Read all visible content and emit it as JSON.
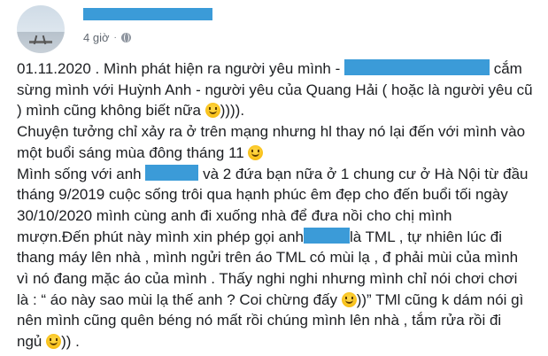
{
  "post": {
    "timestamp": "4 giờ",
    "separator": "·",
    "lines": [
      [
        "01.11.2020 . Mình phát hiện ra người yêu mình - ",
        " cắm"
      ],
      [
        "sừng mình với Huỳnh Anh - người yêu của Quang Hải ( hoặc là người yêu cũ"
      ],
      [
        ") mình cũng không biết nữa ",
        "))))."
      ],
      [
        "Chuyện tưởng chỉ xảy ra ở trên mạng nhưng hl thay nó lại đến với mình vào"
      ],
      [
        "một buổi sáng mùa đông tháng 11 ",
        ""
      ],
      [
        "Mình sống với anh ",
        " và 2 đứa bạn nữa ở 1 chung cư ở Hà Nội từ đầu"
      ],
      [
        "tháng 9/2019 cuộc sống trôi qua hạnh phúc êm đẹp cho đến buổi tối ngày"
      ],
      [
        "30/10/2020 mình cùng anh đi xuống nhà để đưa nồi cho chị mình"
      ],
      [
        "mượn.Đến phút này mình xin phép gọi anh",
        "là TML , tự nhiên lúc đi"
      ],
      [
        "thang máy lên nhà , mình ngửi trên áo TML có mùi lạ , đ phải mùi của mình"
      ],
      [
        "vì nó đang mặc áo của mình . Thấy nghi nghi nhưng mình chỉ nói chơi chơi"
      ],
      [
        "là : “ áo này sao mùi lạ thế anh ? Coi chừng đấy ",
        "))” TMl cũng k dám nói gì"
      ],
      [
        "nên mình cũng quên béng nó mất rồi chúng mình lên nhà , tắm rửa rồi đi"
      ],
      [
        "ngủ ",
        ")) ."
      ]
    ]
  },
  "colors": {
    "redaction": "#3b9bd8",
    "text": "#1c1e21",
    "meta": "#606770"
  },
  "icons": {
    "privacy": "globe-icon",
    "emoji": "slightly-smiling-face-icon"
  }
}
